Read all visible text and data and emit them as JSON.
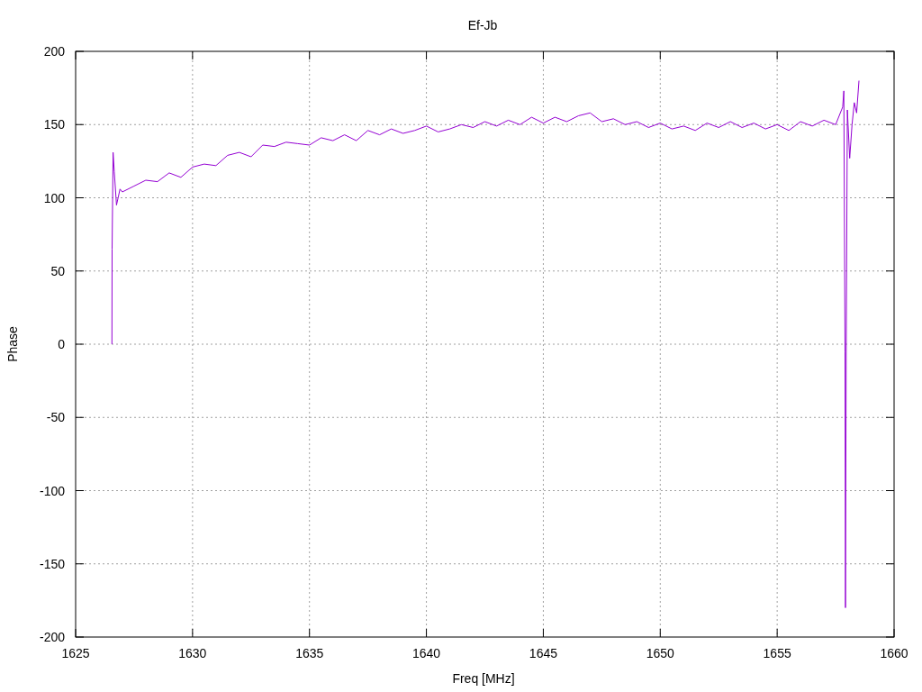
{
  "plot": {
    "chart_data": {
      "type": "line",
      "grid": true,
      "title": "Ef-Jb",
      "xlabel": "Freq [MHz]",
      "ylabel": "Phase",
      "xlim": [
        1625,
        1660
      ],
      "ylim": [
        -200,
        200
      ],
      "xticks": [
        1625,
        1630,
        1635,
        1640,
        1645,
        1650,
        1655,
        1660
      ],
      "yticks": [
        -200,
        -150,
        -100,
        -50,
        0,
        50,
        100,
        150,
        200
      ],
      "x": [
        1626.55,
        1626.56,
        1626.6,
        1626.65,
        1626.75,
        1626.9,
        1627,
        1627.5,
        1628,
        1628.5,
        1629,
        1629.5,
        1630,
        1630.5,
        1631,
        1631.5,
        1632,
        1632.5,
        1633,
        1633.5,
        1634,
        1634.5,
        1635,
        1635.5,
        1636,
        1636.5,
        1637,
        1637.5,
        1638,
        1638.5,
        1639,
        1639.5,
        1640,
        1640.5,
        1641,
        1641.5,
        1642,
        1642.5,
        1643,
        1643.5,
        1644,
        1644.5,
        1645,
        1645.5,
        1646,
        1646.5,
        1647,
        1647.5,
        1648,
        1648.5,
        1649,
        1649.5,
        1650,
        1650.5,
        1651,
        1651.5,
        1652,
        1652.5,
        1653,
        1653.5,
        1654,
        1654.5,
        1655,
        1655.5,
        1656,
        1656.5,
        1657,
        1657.5,
        1657.8,
        1657.85,
        1657.9,
        1657.92,
        1657.95,
        1658,
        1658.1,
        1658.2,
        1658.3,
        1658.4,
        1658.5
      ],
      "series": [
        {
          "color": "#9400d3",
          "values": [
            0,
            65,
            131,
            118,
            95,
            106,
            104,
            108,
            112,
            111,
            117,
            114,
            121,
            123,
            122,
            129,
            131,
            128,
            136,
            135,
            138,
            137,
            136,
            141,
            139,
            143,
            139,
            146,
            143,
            147,
            144,
            146,
            149,
            145,
            147,
            150,
            148,
            152,
            149,
            153,
            150,
            155,
            151,
            155,
            152,
            156,
            158,
            152,
            154,
            150,
            152,
            148,
            151,
            147,
            149,
            146,
            151,
            148,
            152,
            148,
            151,
            147,
            150,
            146,
            152,
            149,
            153,
            150,
            162,
            173,
            -5,
            -180,
            -8,
            160,
            127,
            150,
            165,
            158,
            180
          ]
        }
      ]
    }
  }
}
